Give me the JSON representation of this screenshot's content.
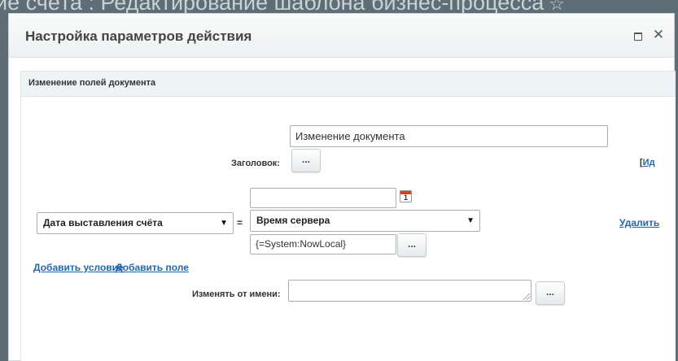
{
  "background": {
    "title": "ие счёта : Редактирование шаблона бизнес-процесса",
    "star_icon": "star-icon"
  },
  "dialog": {
    "title": "Настройка параметров действия",
    "maximize_icon": "maximize-icon",
    "close_icon": "close-icon",
    "close_glyph": "✕"
  },
  "section": {
    "title": "Изменение полей документа"
  },
  "form": {
    "title_label": "Заголовок:",
    "title_value": "Изменение документа",
    "title_dots": "...",
    "id_prefix": "[",
    "id_link": "Ид",
    "field_select": "Дата выставления счёта",
    "equals": "=",
    "date_value": "",
    "calendar_day": "1",
    "time_select": "Время сервера",
    "expression_value": "{=System:NowLocal}",
    "expression_dots": "...",
    "delete_link": "Удалить",
    "add_condition": "Добавить условие",
    "add_field": "Добавить поле",
    "modify_as_label": "Изменять от имени:",
    "modify_as_value": "",
    "modify_as_dots": "..."
  },
  "colors": {
    "link": "#2067b0",
    "header_bg": "#eef3f5",
    "backdrop": "#5f6e76"
  }
}
